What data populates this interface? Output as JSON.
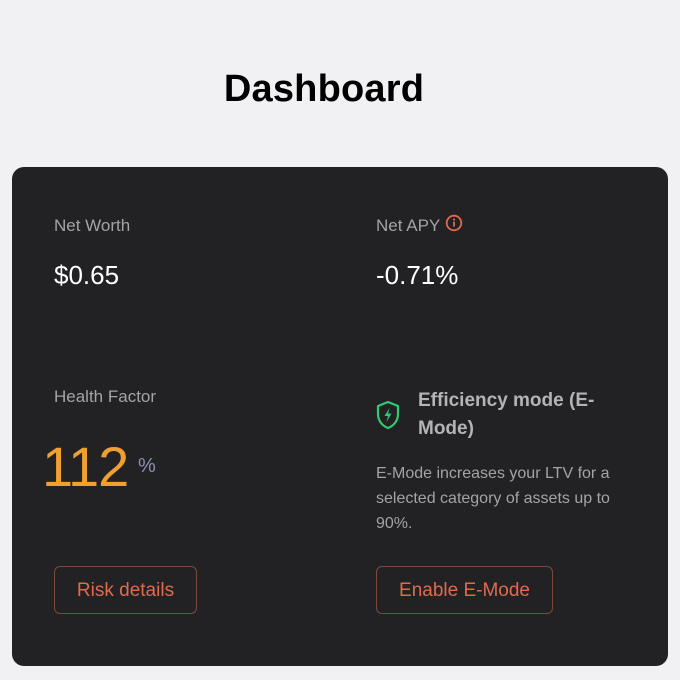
{
  "page": {
    "title": "Dashboard"
  },
  "summary": {
    "net_worth_label": "Net Worth",
    "net_worth_currency": "$",
    "net_worth_value": "0.65",
    "net_apy_label": "Net APY",
    "net_apy_value": "-0.71%",
    "health_factor_label": "Health Factor",
    "health_factor_value": "112",
    "health_factor_unit": "%"
  },
  "emode": {
    "title": "Efficiency mode (E-Mode)",
    "description": "E-Mode increases your LTV for a selected category of assets up to 90%.",
    "icon": "shield-lightning-icon"
  },
  "buttons": {
    "risk_details": "Risk details",
    "enable_emode": "Enable E-Mode"
  },
  "colors": {
    "background": "#f1f1f3",
    "card": "#222224",
    "accent": "#e06a4c",
    "health": "#f0a030",
    "shield": "#2ecc71",
    "info": "#e06a4c"
  }
}
